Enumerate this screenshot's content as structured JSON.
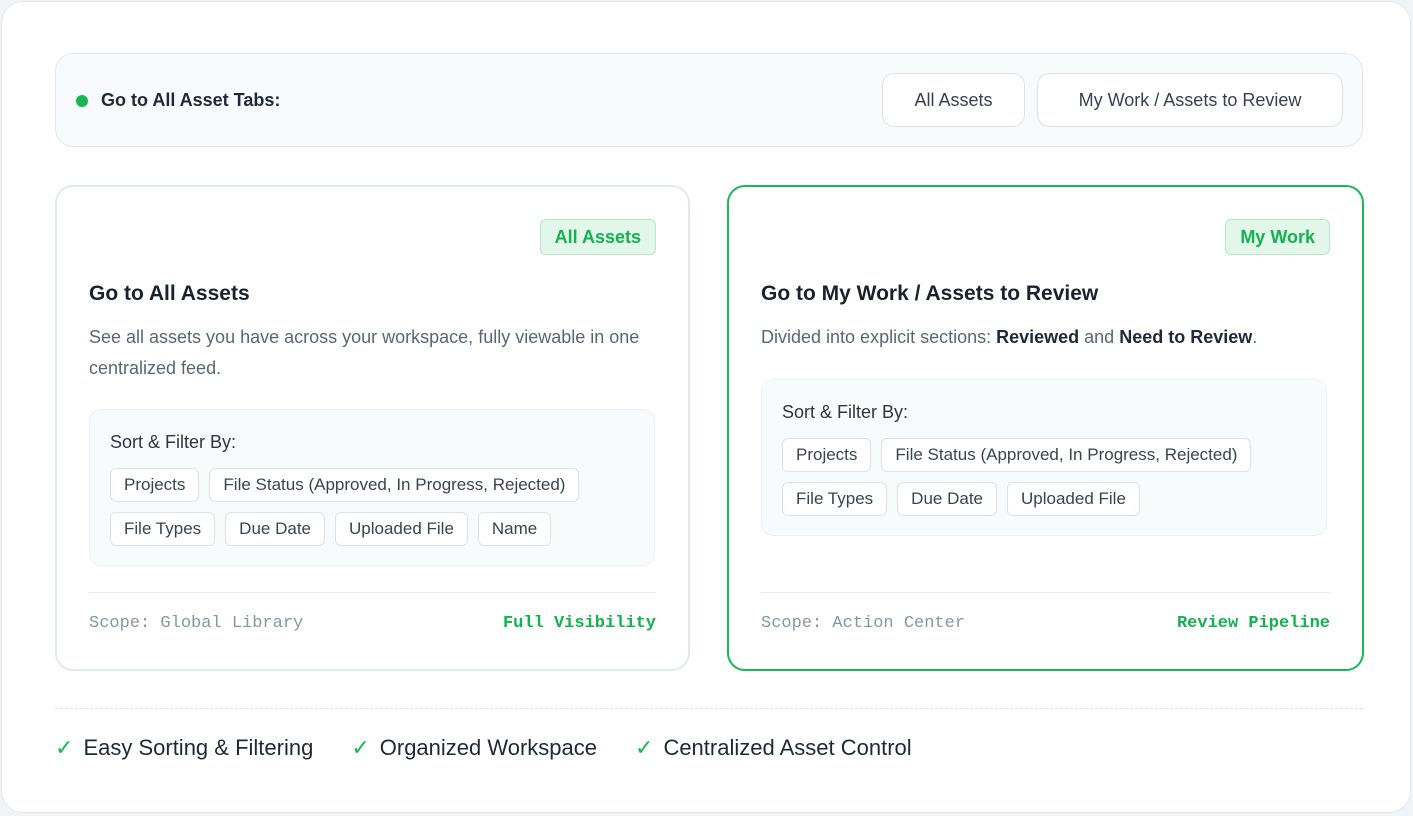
{
  "topbar": {
    "label": "Go to All Asset Tabs:",
    "tabs": [
      {
        "label": "All Assets"
      },
      {
        "label": "My Work / Assets to Review"
      }
    ]
  },
  "cards": [
    {
      "badge": "All Assets",
      "title": "Go to All Assets",
      "description": "See all assets you have across your workspace, fully viewable in one centralized feed.",
      "filter_title": "Sort & Filter By:",
      "chips": [
        "Projects",
        "File Status (Approved, In Progress, Rejected)",
        "File Types",
        "Due Date",
        "Uploaded File",
        "Name"
      ],
      "scope": "Scope: Global Library",
      "status": "Full Visibility"
    },
    {
      "badge": "My Work",
      "title": "Go to My Work / Assets to Review",
      "description_prefix": "Divided into explicit sections: ",
      "description_bold_1": "Reviewed",
      "description_mid": " and ",
      "description_bold_2": "Need to Review",
      "description_suffix": ".",
      "filter_title": "Sort & Filter By:",
      "chips": [
        "Projects",
        "File Status (Approved, In Progress, Rejected)",
        "File Types",
        "Due Date",
        "Uploaded File"
      ],
      "scope": "Scope: Action Center",
      "status": "Review Pipeline"
    }
  ],
  "features": [
    {
      "icon": "check-icon",
      "label": "Easy Sorting & Filtering"
    },
    {
      "icon": "check-icon",
      "label": "Organized Workspace"
    },
    {
      "icon": "check-icon",
      "label": "Centralized Asset Control"
    }
  ],
  "check_glyph": "✓",
  "colors": {
    "accent": "#17b955",
    "badge_bg": "#e2f6ea",
    "text_dark": "#1f2937",
    "text_muted": "#5b6675"
  }
}
